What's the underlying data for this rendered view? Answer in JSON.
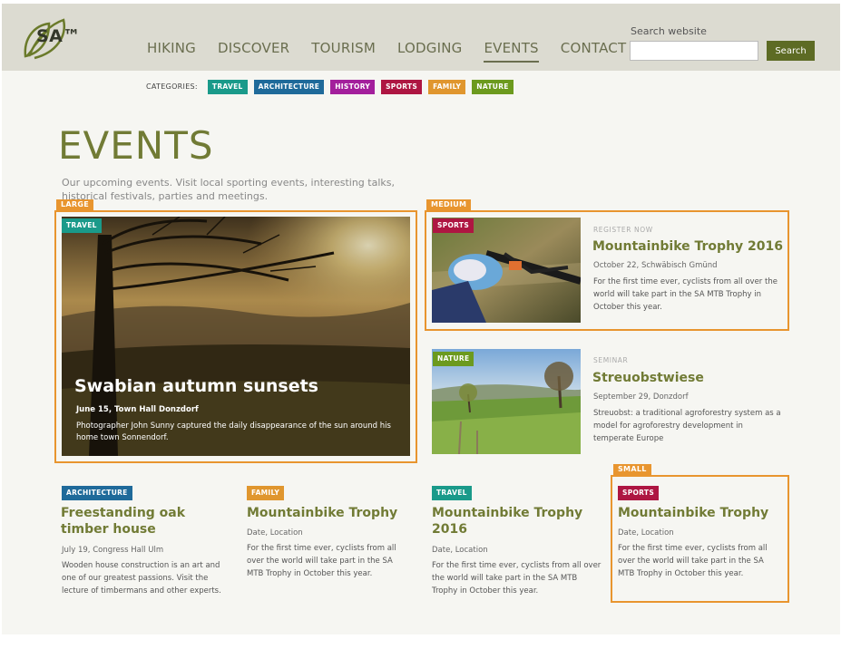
{
  "brand": {
    "name": "SA™"
  },
  "nav": [
    "HIKING",
    "DISCOVER",
    "TOURISM",
    "LODGING",
    "EVENTS",
    "CONTACT"
  ],
  "search": {
    "label": "Search website",
    "value": "",
    "button": "Search"
  },
  "categories": {
    "label": "CATEGORIES:",
    "items": [
      {
        "label": "TRAVEL",
        "color": "#1a9a8a"
      },
      {
        "label": "ARCHITECTURE",
        "color": "#1f6a9a"
      },
      {
        "label": "HISTORY",
        "color": "#a31f9c"
      },
      {
        "label": "SPORTS",
        "color": "#ae1642"
      },
      {
        "label": "FAMILY",
        "color": "#e0962e"
      },
      {
        "label": "NATURE",
        "color": "#6c9a1e"
      }
    ]
  },
  "page": {
    "title": "EVENTS",
    "intro": "Our upcoming events. Visit local sporting events, interesting talks, historical festivals, parties and meetings."
  },
  "size_labels": {
    "large": "LARGE",
    "medium": "MEDIUM",
    "small": "SMALL"
  },
  "accent_color": "#e8952f",
  "large_card": {
    "badge": "TRAVEL",
    "title": "Swabian autumn sunsets",
    "meta": "June 15, Town Hall Donzdorf",
    "desc": "Photographer John Sunny captured the daily disappearance of the sun around his home town Sonnendorf."
  },
  "medium_cards": [
    {
      "badge": "SPORTS",
      "kicker": "REGISTER NOW",
      "title": "Mountainbike Trophy 2016",
      "meta": "October 22, Schwäbisch Gmünd",
      "desc": "For the first time ever, cyclists from all over the world will take part in the SA MTB Trophy in October this year."
    },
    {
      "badge": "NATURE",
      "kicker": "SEMINAR",
      "title": "Streuobstwiese",
      "meta": "September 29, Donzdorf",
      "desc": "Streuobst: a traditional agroforestry system as a model for agroforestry development in temperate Europe"
    }
  ],
  "small_cards": [
    {
      "badge": "ARCHITECTURE",
      "title": "Freestanding oak timber house",
      "meta": "July 19, Congress Hall Ulm",
      "desc": "Wooden house construction is an art and one of our greatest passions. Visit the lecture of timbermans and other experts."
    },
    {
      "badge": "FAMILY",
      "title": "Mountainbike Trophy",
      "meta": "Date, Location",
      "desc": "For the first time ever, cyclists from all over the world will take part in the SA MTB Trophy in October this year."
    },
    {
      "badge": "TRAVEL",
      "title": "Mountainbike Trophy 2016",
      "meta": "Date, Location",
      "desc": "For the first time ever, cyclists from all over the world will take part in the SA MTB Trophy in October this year."
    },
    {
      "badge": "SPORTS",
      "title": "Mountainbike Trophy",
      "meta": "Date, Location",
      "desc": "For the first time ever, cyclists from all over the world will take part in the SA MTB Trophy in October this year."
    }
  ]
}
